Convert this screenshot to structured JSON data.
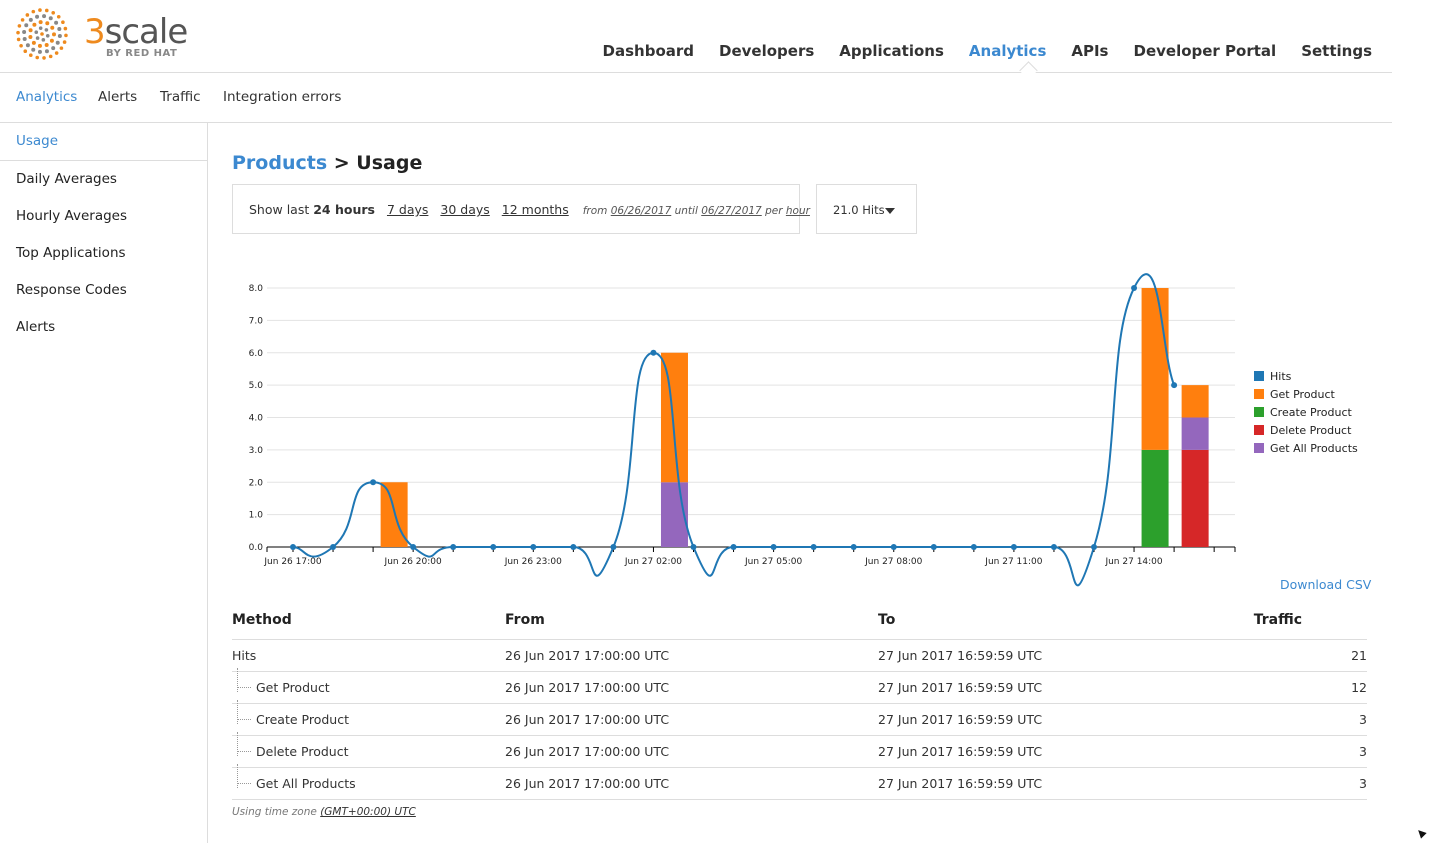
{
  "brand": {
    "name_part1": "3",
    "name_part2": "scale",
    "sub": "BY RED HAT"
  },
  "mainnav": [
    "Dashboard",
    "Developers",
    "Applications",
    "Analytics",
    "APIs",
    "Developer Portal",
    "Settings"
  ],
  "mainnav_active": "Analytics",
  "subnav": [
    "Analytics",
    "Alerts",
    "Traffic",
    "Integration errors"
  ],
  "sidebar": [
    "Usage",
    "Daily Averages",
    "Hourly Averages",
    "Top Applications",
    "Response Codes",
    "Alerts"
  ],
  "title": {
    "link": "Products",
    "rest": " > Usage"
  },
  "range": {
    "show_last": "Show last",
    "current": "24 hours",
    "options": [
      "7 days",
      "30 days",
      "12 months"
    ],
    "from_label": "from",
    "from": "06/26/2017",
    "until_label": "until",
    "until": "06/27/2017",
    "per_label": "per",
    "per": "hour"
  },
  "metric_button": "21.0 Hits",
  "download_csv": "Download CSV",
  "chart_data": {
    "type": "bar",
    "stacked": true,
    "x": [
      "Jun 26 17:00",
      "Jun 26 18:00",
      "Jun 26 19:00",
      "Jun 26 20:00",
      "Jun 26 21:00",
      "Jun 26 22:00",
      "Jun 26 23:00",
      "Jun 27 00:00",
      "Jun 27 01:00",
      "Jun 27 02:00",
      "Jun 27 03:00",
      "Jun 27 04:00",
      "Jun 27 05:00",
      "Jun 27 06:00",
      "Jun 27 07:00",
      "Jun 27 08:00",
      "Jun 27 09:00",
      "Jun 27 10:00",
      "Jun 27 11:00",
      "Jun 27 12:00",
      "Jun 27 13:00",
      "Jun 27 14:00",
      "Jun 27 15:00",
      "Jun 27 16:00"
    ],
    "tick_labels": [
      "Jun 26 17:00",
      "Jun 26 20:00",
      "Jun 26 23:00",
      "Jun 27 02:00",
      "Jun 27 05:00",
      "Jun 27 08:00",
      "Jun 27 11:00",
      "Jun 27 14:00"
    ],
    "y_ticks": [
      "0.0",
      "1.0",
      "2.0",
      "3.0",
      "4.0",
      "5.0",
      "6.0",
      "7.0",
      "8.0"
    ],
    "ylim": [
      0,
      8
    ],
    "line_series": {
      "name": "Hits",
      "color": "#1f77b4",
      "values": [
        0,
        0,
        2,
        0,
        0,
        0,
        0,
        0,
        0,
        6,
        0,
        0,
        0,
        0,
        0,
        0,
        0,
        0,
        0,
        0,
        0,
        8,
        5,
        null
      ]
    },
    "series": [
      {
        "name": "Get Product",
        "color": "#ff7f0e",
        "values": [
          0,
          0,
          2,
          0,
          0,
          0,
          0,
          0,
          0,
          4,
          0,
          0,
          0,
          0,
          0,
          0,
          0,
          0,
          0,
          0,
          0,
          5,
          1,
          0
        ]
      },
      {
        "name": "Create Product",
        "color": "#2ca02c",
        "values": [
          0,
          0,
          0,
          0,
          0,
          0,
          0,
          0,
          0,
          0,
          0,
          0,
          0,
          0,
          0,
          0,
          0,
          0,
          0,
          0,
          0,
          3,
          0,
          0
        ]
      },
      {
        "name": "Delete Product",
        "color": "#d62728",
        "values": [
          0,
          0,
          0,
          0,
          0,
          0,
          0,
          0,
          0,
          0,
          0,
          0,
          0,
          0,
          0,
          0,
          0,
          0,
          0,
          0,
          0,
          0,
          3,
          0
        ]
      },
      {
        "name": "Get All Products",
        "color": "#9467bd",
        "values": [
          0,
          0,
          0,
          0,
          0,
          0,
          0,
          0,
          0,
          2,
          0,
          0,
          0,
          0,
          0,
          0,
          0,
          0,
          0,
          0,
          0,
          0,
          1,
          0
        ]
      }
    ],
    "legend": [
      "Hits",
      "Get Product",
      "Create Product",
      "Delete Product",
      "Get All Products"
    ],
    "legend_position": "right",
    "grid": true
  },
  "table": {
    "headers": [
      "Method",
      "From",
      "To",
      "Traffic"
    ],
    "rows": [
      {
        "method": "Hits",
        "from": "26 Jun 2017 17:00:00 UTC",
        "to": "27 Jun 2017 16:59:59 UTC",
        "traffic": "21",
        "child": false
      },
      {
        "method": "Get Product",
        "from": "26 Jun 2017 17:00:00 UTC",
        "to": "27 Jun 2017 16:59:59 UTC",
        "traffic": "12",
        "child": true
      },
      {
        "method": "Create Product",
        "from": "26 Jun 2017 17:00:00 UTC",
        "to": "27 Jun 2017 16:59:59 UTC",
        "traffic": "3",
        "child": true
      },
      {
        "method": "Delete Product",
        "from": "26 Jun 2017 17:00:00 UTC",
        "to": "27 Jun 2017 16:59:59 UTC",
        "traffic": "3",
        "child": true
      },
      {
        "method": "Get All Products",
        "from": "26 Jun 2017 17:00:00 UTC",
        "to": "27 Jun 2017 16:59:59 UTC",
        "traffic": "3",
        "child": true
      }
    ]
  },
  "timezone": {
    "label": "Using time zone",
    "value": "(GMT+00:00) UTC"
  }
}
